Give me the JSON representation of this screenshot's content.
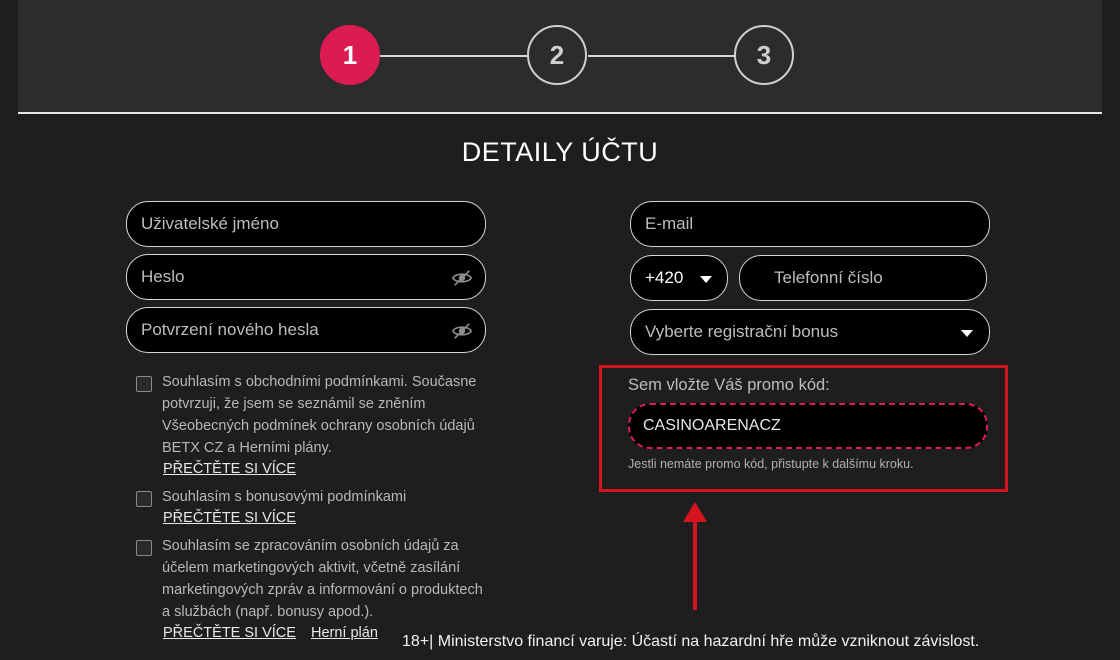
{
  "stepper": {
    "steps": [
      "1",
      "2",
      "3"
    ],
    "active_step": "1"
  },
  "page_title": "DETAILY ÚČTU",
  "left_fields": {
    "username_placeholder": "Uživatelské jméno",
    "password_placeholder": "Heslo",
    "confirm_password_placeholder": "Potvrzení nového hesla"
  },
  "right_fields": {
    "email_placeholder": "E-mail",
    "phone_prefix": "+420",
    "phone_placeholder": "Telefonní číslo",
    "bonus_select": "Vyberte registrační bonus"
  },
  "consents": [
    {
      "lines": [
        "Souhlasím s obchodními podmínkami. Současne",
        "potvrzuji, že jsem se seznámil se zněním",
        "Všeobecných podmínek ochrany osobních údajů",
        "BETX CZ a Herními plány."
      ],
      "link": "PŘEČTĚTE SI VÍCE"
    },
    {
      "lines": [
        "Souhlasím s bonusovými podmínkami"
      ],
      "link": "PŘEČTĚTE SI VÍCE"
    },
    {
      "lines": [
        "Souhlasím se zpracováním osobních údajů za",
        "účelem marketingových aktivit, včetně zasílání",
        "marketingových zpráv a informování o produktech",
        "a službách (např. bonusy apod.)."
      ],
      "link": "PŘEČTĚTE SI VÍCE",
      "link2": "Herní plán"
    }
  ],
  "promo": {
    "label": "Sem vložte Váš promo kód:",
    "value": "CASINOARENACZ",
    "hint": "Jestli nemáte promo kód, přistupte k dalšímu kroku."
  },
  "footer_warning": "18+| Ministerstvo financí varuje: Účastí na hazardní hře může vzniknout závislost.",
  "colors": {
    "accent": "#db1c53",
    "highlight_box": "#d4151f",
    "background": "#1e1e1e"
  }
}
